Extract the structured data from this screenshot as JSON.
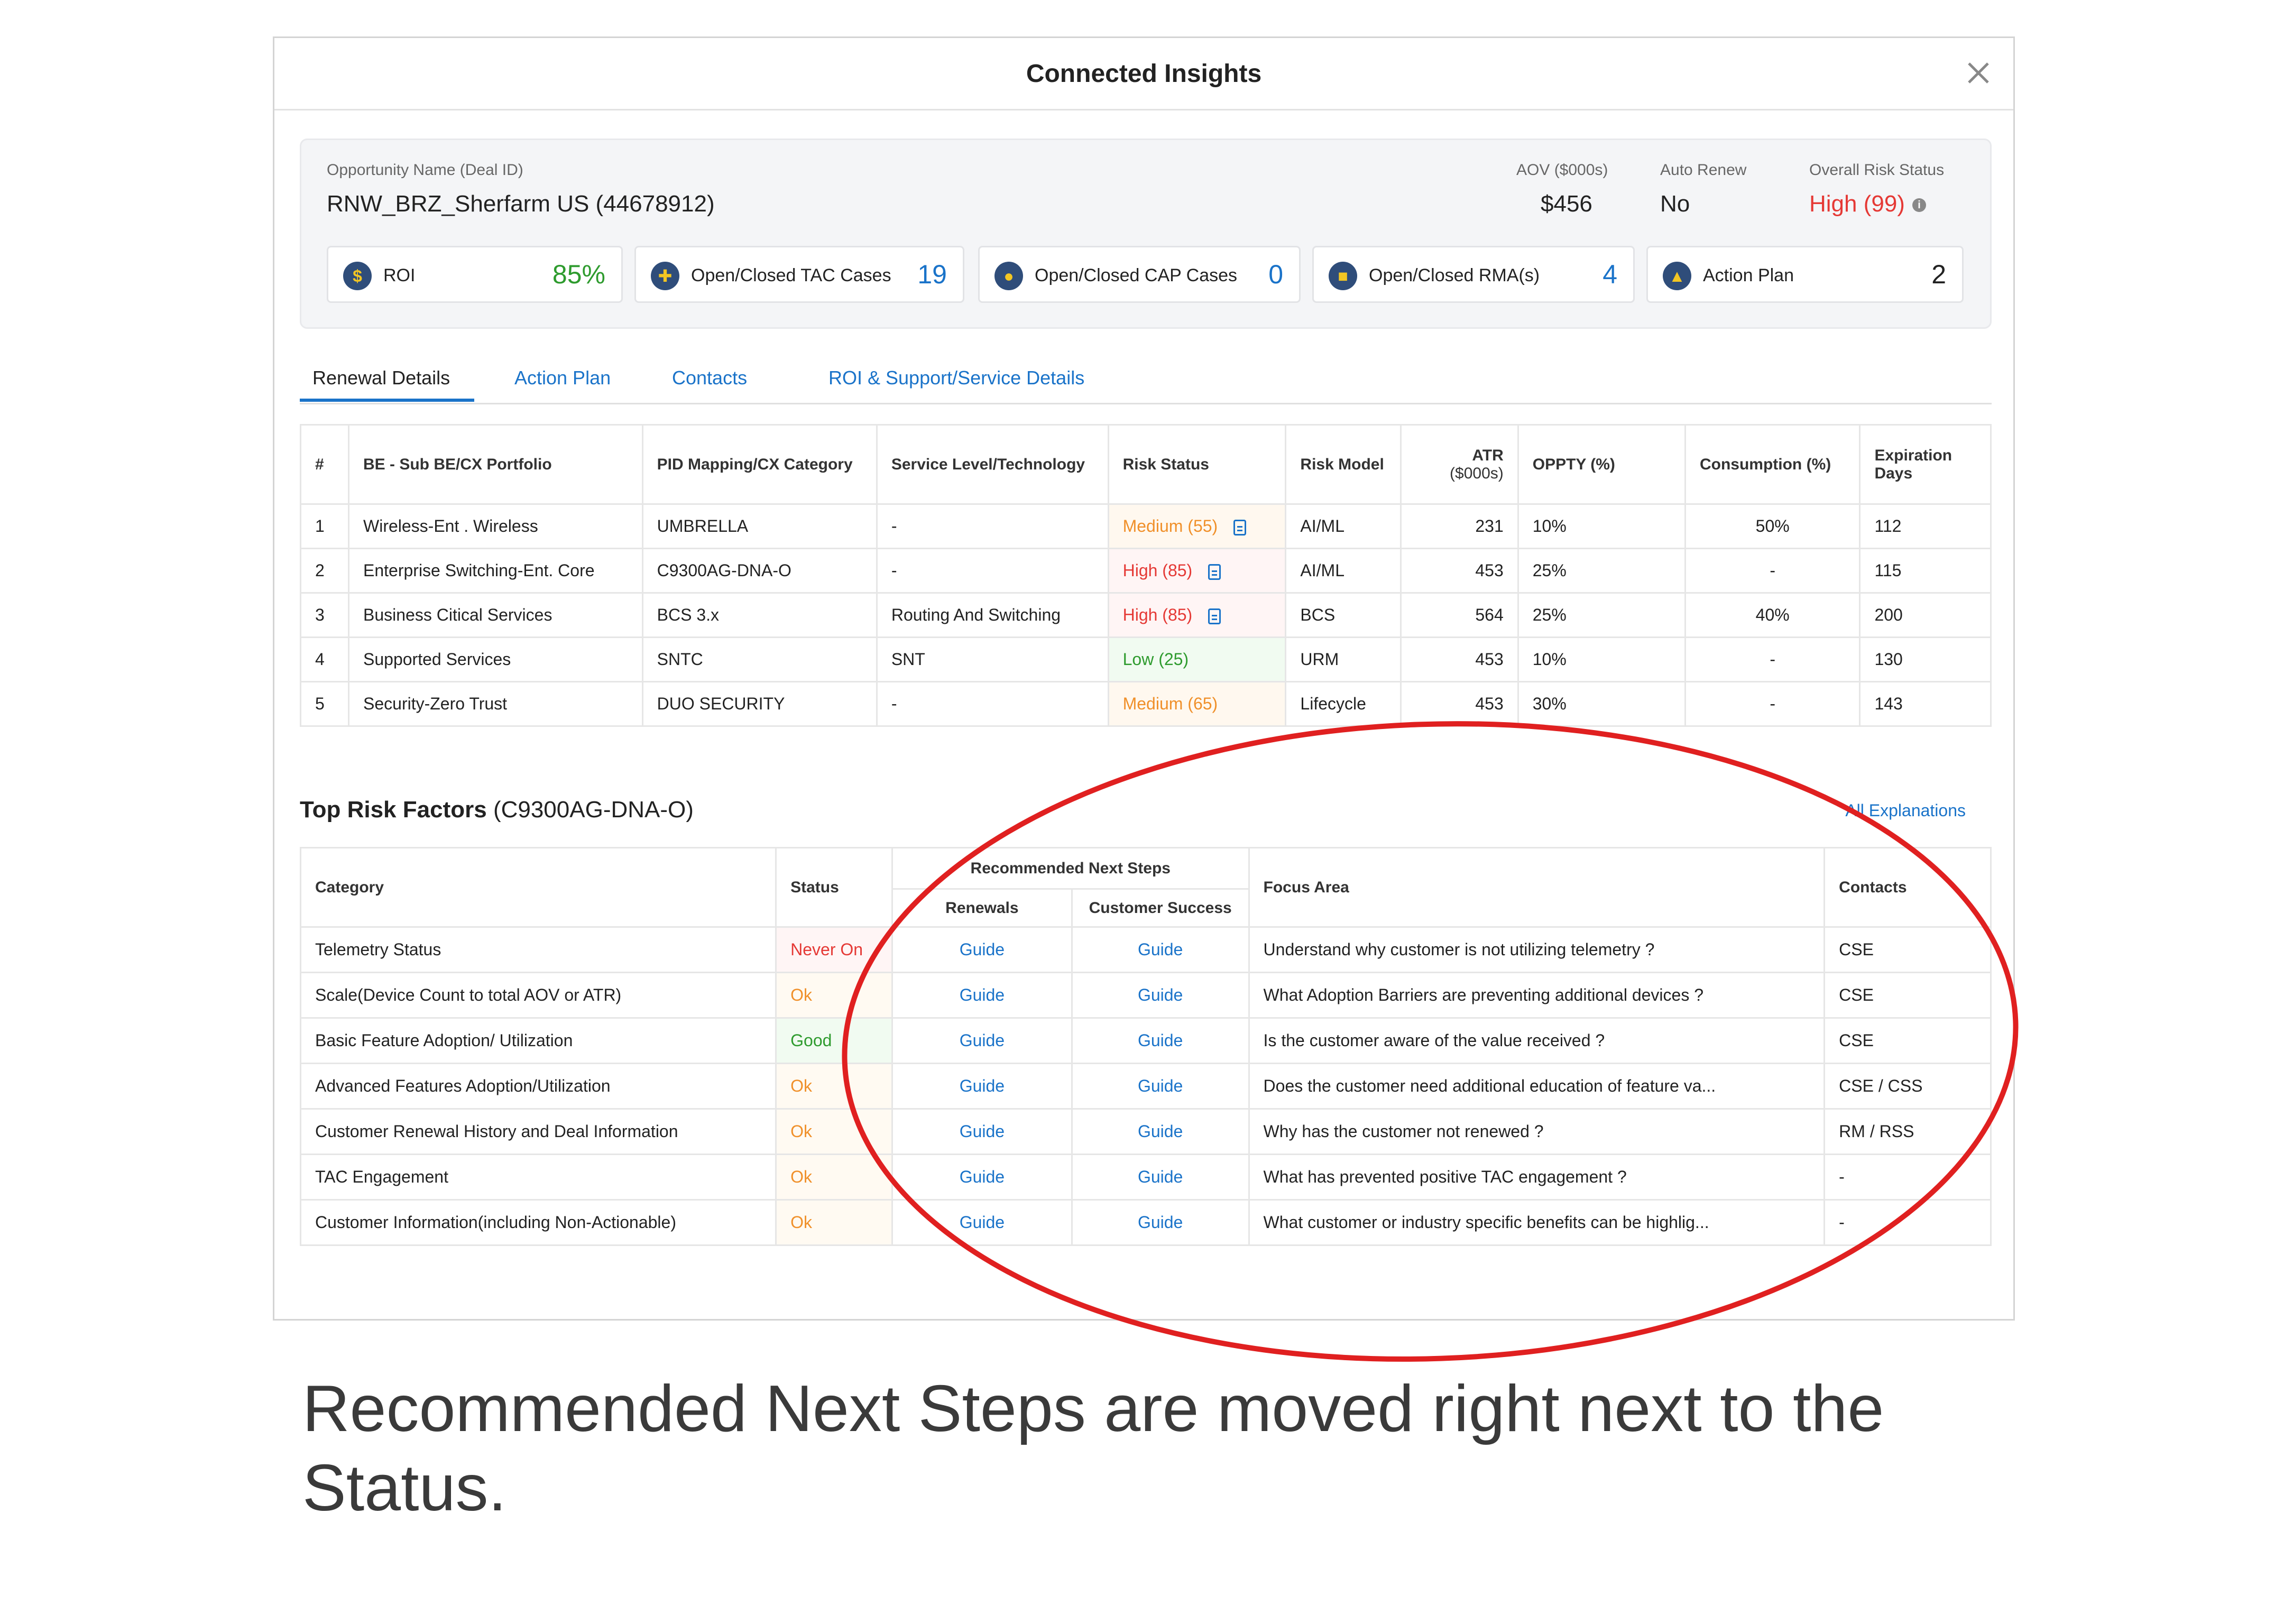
{
  "modal": {
    "title": "Connected Insights"
  },
  "summary": {
    "opportunity_label": "Opportunity Name (Deal ID)",
    "opportunity_value": "RNW_BRZ_Sherfarm US (44678912)",
    "aov_label": "AOV ($000s)",
    "aov_value": "$456",
    "auto_renew_label": "Auto Renew",
    "auto_renew_value": "No",
    "risk_label": "Overall Risk Status",
    "risk_value": "High (99)",
    "metrics": [
      {
        "label": "ROI",
        "value": "85%",
        "icon": "dollar-icon",
        "color": "#2e9b2e"
      },
      {
        "label": "Open/Closed TAC Cases",
        "value": "19",
        "icon": "tools-icon",
        "color": "#1a73c9"
      },
      {
        "label": "Open/Closed CAP Cases",
        "value": "0",
        "icon": "user-icon",
        "color": "#1a73c9"
      },
      {
        "label": "Open/Closed RMA(s)",
        "value": "4",
        "icon": "box-icon",
        "color": "#1a73c9"
      },
      {
        "label": "Action Plan",
        "value": "2",
        "icon": "warning-icon",
        "color": "#222222"
      }
    ]
  },
  "tabs": [
    "Renewal Details",
    "Action Plan",
    "Contacts",
    "ROI & Support/Service Details"
  ],
  "renewal_table": {
    "headers": [
      "#",
      "BE - Sub BE/CX Portfolio",
      "PID Mapping/CX Category",
      "Service Level/Technology",
      "Risk Status",
      "Risk Model",
      "ATR",
      "($000s)",
      "OPPTY (%)",
      "Consumption (%)",
      "Expiration",
      "Days"
    ],
    "rows": [
      {
        "n": "1",
        "portfolio": "Wireless-Ent . Wireless",
        "pid": "UMBRELLA",
        "service": "-",
        "risk": "Medium (55)",
        "level": "med",
        "note": true,
        "model": "AI/ML",
        "atr": "231",
        "oppty": "10%",
        "consumption": "50%",
        "days": "112"
      },
      {
        "n": "2",
        "portfolio": "Enterprise Switching-Ent. Core",
        "pid": "C9300AG-DNA-O",
        "service": "-",
        "risk": "High (85)",
        "level": "high",
        "note": true,
        "model": "AI/ML",
        "atr": "453",
        "oppty": "25%",
        "consumption": "-",
        "days": "115"
      },
      {
        "n": "3",
        "portfolio": "Business Citical Services",
        "pid": "BCS 3.x",
        "service": "Routing And Switching",
        "risk": "High (85)",
        "level": "high",
        "note": true,
        "model": "BCS",
        "atr": "564",
        "oppty": "25%",
        "consumption": "40%",
        "days": "200"
      },
      {
        "n": "4",
        "portfolio": "Supported Services",
        "pid": "SNTC",
        "service": "SNT",
        "risk": "Low (25)",
        "level": "low",
        "note": false,
        "model": "URM",
        "atr": "453",
        "oppty": "10%",
        "consumption": "-",
        "days": "130"
      },
      {
        "n": "5",
        "portfolio": "Security-Zero Trust",
        "pid": "DUO SECURITY",
        "service": "-",
        "risk": "Medium (65)",
        "level": "med",
        "note": false,
        "model": "Lifecycle",
        "atr": "453",
        "oppty": "30%",
        "consumption": "-",
        "days": "143"
      }
    ]
  },
  "risk_factors": {
    "title": "Top Risk Factors",
    "pid": "(C9300AG-DNA-O)",
    "all_explanations": "All Explanations",
    "headers": {
      "category": "Category",
      "status": "Status",
      "next_steps": "Recommended Next Steps",
      "renewals": "Renewals",
      "customer_success": "Customer Success",
      "focus_area": "Focus Area",
      "contacts": "Contacts"
    },
    "rows": [
      {
        "category": "Telemetry Status",
        "status": "Never On",
        "level": "never",
        "renewals": "Guide",
        "cs": "Guide",
        "focus": "Understand why customer is not utilizing telemetry ?",
        "contacts": "CSE"
      },
      {
        "category": "Scale(Device Count to total AOV or ATR)",
        "status": "Ok",
        "level": "ok",
        "renewals": "Guide",
        "cs": "Guide",
        "focus": "What Adoption Barriers are preventing additional devices ?",
        "contacts": "CSE"
      },
      {
        "category": "Basic Feature Adoption/ Utilization",
        "status": "Good",
        "level": "good",
        "renewals": "Guide",
        "cs": "Guide",
        "focus": "Is the customer aware of the value received ?",
        "contacts": "CSE"
      },
      {
        "category": "Advanced Features Adoption/Utilization",
        "status": "Ok",
        "level": "ok",
        "renewals": "Guide",
        "cs": "Guide",
        "focus": "Does the customer need additional education  of feature va...",
        "contacts": "CSE / CSS"
      },
      {
        "category": "Customer Renewal History and Deal Information",
        "status": "Ok",
        "level": "ok",
        "renewals": "Guide",
        "cs": "Guide",
        "focus": "Why has the customer not renewed ?",
        "contacts": "RM / RSS"
      },
      {
        "category": "TAC Engagement",
        "status": "Ok",
        "level": "ok",
        "renewals": "Guide",
        "cs": "Guide",
        "focus": "What has prevented positive TAC engagement ?",
        "contacts": "-"
      },
      {
        "category": "Customer Information(including Non-Actionable)",
        "status": "Ok",
        "level": "ok",
        "renewals": "Guide",
        "cs": "Guide",
        "focus": "What customer or industry specific benefits can be highlig...",
        "contacts": "-"
      }
    ]
  },
  "caption": "Recommended Next Steps are moved right next to the Status.",
  "colors": {
    "accent": "#1a73c9",
    "high": "#e53935",
    "medium": "#f0902a",
    "low": "#2e9b2e",
    "annotation": "#e02020"
  }
}
